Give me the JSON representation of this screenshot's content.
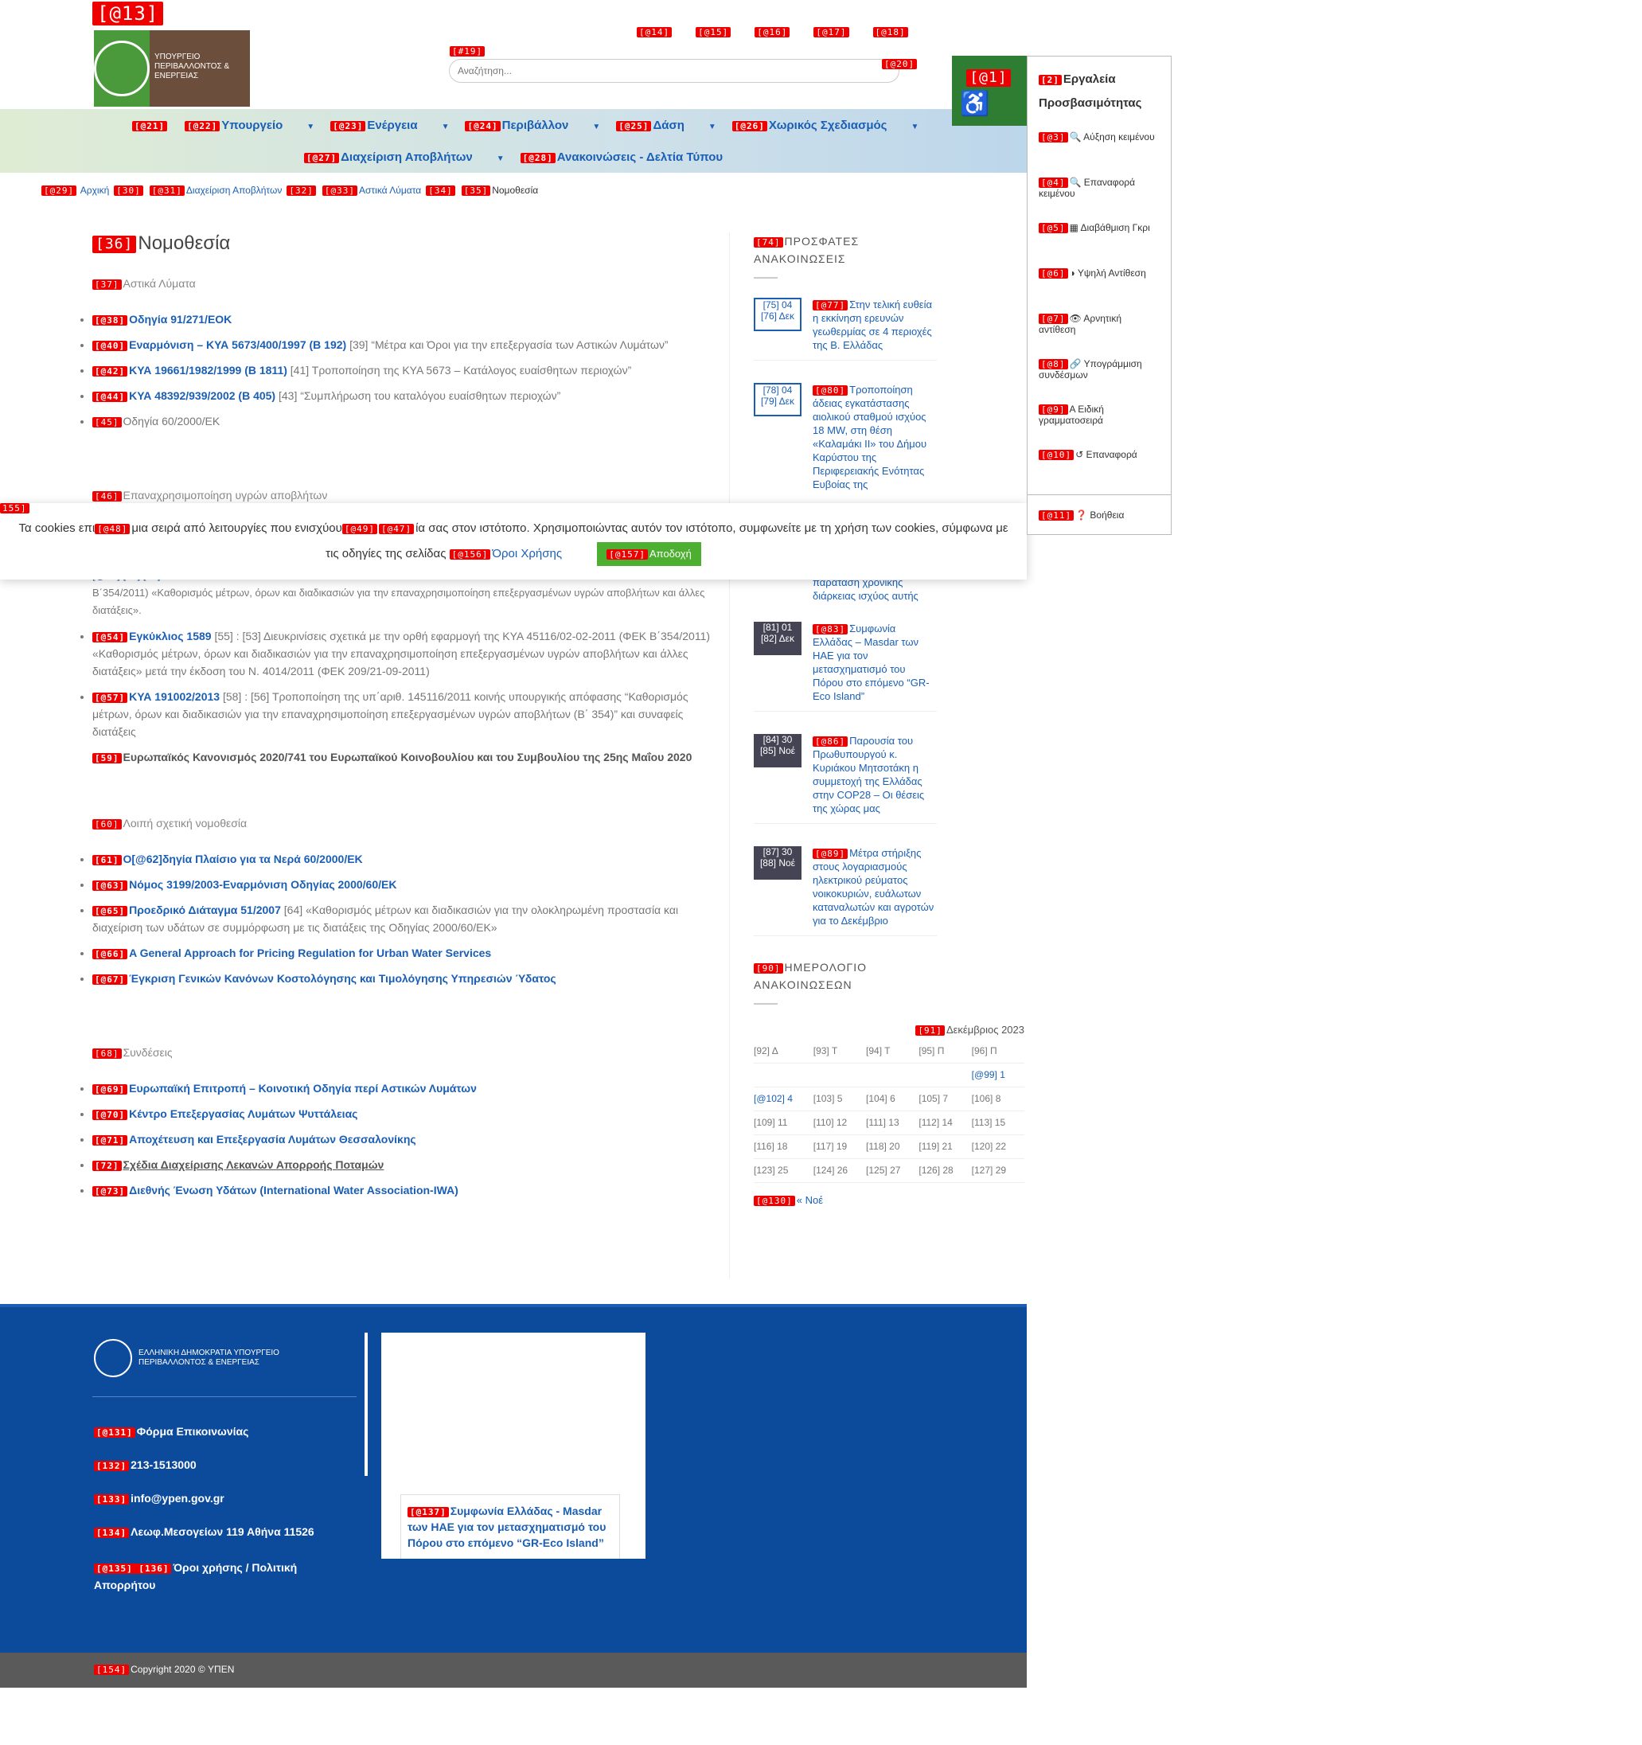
{
  "header": {
    "logo_tag": "[@13]",
    "logo_text": "ΥΠΟΥΡΓΕΙΟ ΠΕΡΙΒΑΛΛΟΝΤΟΣ & ΕΝΕΡΓΕΙΑΣ",
    "toplinks": [
      "[@14]",
      "[@15]",
      "[@16]",
      "[@17]",
      "[@18]"
    ],
    "search_tag": "[#19]",
    "search_placeholder": "Αναζήτηση...",
    "search_btn_tag": "[@20]"
  },
  "nav": {
    "row1": [
      {
        "tag": "[@21]",
        "label": ""
      },
      {
        "tag": "[@22]",
        "label": "Υπουργείο"
      },
      {
        "tag": "[@23]",
        "label": "Ενέργεια"
      },
      {
        "tag": "[@24]",
        "label": "Περιβάλλον"
      },
      {
        "tag": "[@25]",
        "label": "Δάση"
      },
      {
        "tag": "[@26]",
        "label": "Χωρικός Σχεδιασμός"
      }
    ],
    "row2": [
      {
        "tag": "[@27]",
        "label": "Διαχείριση Αποβλήτων"
      },
      {
        "tag": "[@28]",
        "label": "Ανακοινώσεις - Δελτία Τύπου"
      }
    ]
  },
  "breadcrumb": [
    {
      "tag": "[@29]",
      "label": "Αρχική"
    },
    {
      "tag": "[30]",
      "label": ""
    },
    {
      "tag": "[@31]",
      "label": "Διαχείριση Αποβλήτων"
    },
    {
      "tag": "[32]",
      "label": ""
    },
    {
      "tag": "[@33]",
      "label": "Αστικά Λύματα"
    },
    {
      "tag": "[34]",
      "label": ""
    },
    {
      "tag": "[35]",
      "label": "Νομοθεσία"
    }
  ],
  "main": {
    "title_tag": "[36]",
    "title": "Νομοθεσία",
    "s1_tag": "[37]",
    "s1": "Αστικά Λύματα",
    "l1": [
      {
        "tag": "[@38]",
        "link": "Οδηγία 91/271/ΕΟΚ",
        "text": ""
      },
      {
        "tag": "[@40]",
        "link": "Εναρμόνιση – ΚΥΑ 5673/400/1997 (Β 192)",
        "text": "[39] “Μέτρα και Όροι για την επεξεργασία των Αστικών Λυμάτων”"
      },
      {
        "tag": "[@42]",
        "link": "ΚΥΑ 19661/1982/1999 (Β 1811)",
        "text": "[41] Τροποποίηση της ΚΥΑ 5673 – Κατάλογος ευαίσθητων περιοχών”"
      },
      {
        "tag": "[@44]",
        "link": "ΚΥΑ 48392/939/2002 (Β 405)",
        "text": "[43] “Συμπλήρωση του καταλόγου ευαίσθητων περιοχών”"
      },
      {
        "tag": "[45]",
        "link": "",
        "text": "Οδηγία 60/2000/ΕΚ"
      }
    ],
    "s2_tag": "[46]",
    "s2": "Επαναχρησιμοποίηση υγρών αποβλήτων",
    "l2_partial": "[@51]                         [52] [50]",
    "l2_text": "Β΄354/2011) «Καθορισμός μέτρων, όρων και διαδικασιών για την επαναχρησιμοποίηση επεξεργασμένων υγρών αποβλήτων και άλλες διατάξεις».",
    "l2": [
      {
        "tag": "[@54]",
        "link": "Εγκύκλιος 1589",
        "text": "[55] : [53] Διευκρινίσεις σχετικά με την ορθή εφαρμογή της ΚΥΑ 45116/02-02-2011 (ΦΕΚ Β΄354/2011) «Καθορισμός μέτρων, όρων και διαδικασιών για την επαναχρησιμοποίηση επεξεργασμένων υγρών αποβλήτων και άλλες διατάξεις» μετά την έκδοση του Ν. 4014/2011 (ΦΕΚ 209/21-09-2011)"
      },
      {
        "tag": "[@57]",
        "link": "ΚΥΑ 191002/2013",
        "text": "[58] : [56] Τροποποίηση της υπ΄αριθ. 145116/2011 κοινής υπουργικής απόφασης “Καθορισμός μέτρων, όρων και διαδικασιών για την επαναχρησιμοποίηση επεξεργασμένων υγρών αποβλήτων (Β΄ 354)” και συναφείς διατάξεις"
      }
    ],
    "l2_last_tag": "[59]",
    "l2_last": "Ευρωπαϊκός Κανονισμός 2020/741 του Ευρωπαϊκού Κοινοβουλίου και του Συμβουλίου της 25ης Μαΐου 2020",
    "s3_tag": "[60]",
    "s3": "Λοιπή σχετική νομοθεσία",
    "l3": [
      {
        "tag": "[61]",
        "link": "Ο[@62]δηγία Πλαίσιο για τα Νερά 60/2000/ΕΚ",
        "text": ""
      },
      {
        "tag": "[@63]",
        "link": "Νόμος 3199/2003-Εναρμόνιση Οδηγίας 2000/60/ΕΚ",
        "text": ""
      },
      {
        "tag": "[@65]",
        "link": "Προεδρικό Διάταγμα 51/2007",
        "text": "[64] «Καθορισμός μέτρων και διαδικασιών για την ολοκληρωμένη προστασία και διαχείριση των υδάτων σε συμμόρφωση με τις διατάξεις της Οδηγίας 2000/60/ΕΚ»"
      },
      {
        "tag": "[@66]",
        "link": "A General Approach for Pricing Regulation for Urban Water Services",
        "text": ""
      },
      {
        "tag": "[@67]",
        "link": "Έγκριση Γενικών Κανόνων Κοστολόγησης και Τιμολόγησης Υπηρεσιών Ύδατος",
        "text": ""
      }
    ],
    "s4_tag": "[68]",
    "s4": "Συνδέσεις",
    "l4": [
      {
        "tag": "[@69]",
        "link": "Ευρωπαϊκή Επιτροπή – Κοινοτική Οδηγία περί Αστικών Λυμάτων"
      },
      {
        "tag": "[@70]",
        "link": "Κέντρο Επεξεργασίας Λυμάτων Ψυττάλειας"
      },
      {
        "tag": "[@71]",
        "link": "Αποχέτευση και Επεξεργασία Λυμάτων Θεσσαλονίκης"
      },
      {
        "tag": "[72]",
        "link": "Σχέδια Διαχείρισης Λεκανών Απορροής Ποταμών"
      },
      {
        "tag": "[@73]",
        "link": "Διεθνής Ένωση Υδάτων (International Water Association-IWA)"
      }
    ]
  },
  "sidebar": {
    "news_tag": "[74]",
    "news_title": "ΠΡΟΣΦΑΤΕΣ ΑΝΑΚΟΙΝΩΣΕΙΣ",
    "news": [
      {
        "d": "[75] 04",
        "m": "[76] Δεκ",
        "tag": "[@77]",
        "title": "Στην τελική ευθεία η εκκίνηση ερευνών γεωθερμίας σε 4 περιοχές της Β. Ελλάδας"
      },
      {
        "d": "[78] 04",
        "m": "[79] Δεκ",
        "tag": "[@80]",
        "title": "Τροποποίηση άδειας εγκατάστασης αιολικού σταθμού ισχύος 18 MW, στη θέση «Καλαμάκι ΙΙ» του Δήμου Καρύστου της Περιφερειακής Ενότητας Ευβοίας της"
      },
      {
        "d": "[81] 01",
        "m": "[82] Δεκ",
        "tag": "[@83]",
        "title": "Συμφωνία Ελλάδας – Masdar των ΗΑΕ για τον μετασχηματισμό του Πόρου στο επόμενο “GR-Eco Island”"
      },
      {
        "d": "[84] 30",
        "m": "[85] Νοέ",
        "tag": "[@86]",
        "title": "Παρουσία του Πρωθυπουργού κ. Κυριάκου Μητσοτάκη η συμμετοχή της Ελλάδας στην COP28 – Οι θέσεις της χώρας μας"
      },
      {
        "d": "[87] 30",
        "m": "[88] Νοέ",
        "tag": "[@89]",
        "title": "Μέτρα στήριξης στους λογαριασμούς ηλεκτρικού ρεύματος νοικοκυριών, ευάλωτων καταναλωτών και αγροτών για το Δεκέμβριο"
      }
    ],
    "news_fragment": "λόγω αλλαγής θέσης ανεμογεννητριών και παράταση χρονικής διάρκειας ισχύος αυτής",
    "cal_tag": "[90]",
    "cal_title": "ΗΜΕΡΟΛΟΓΙΟ ΑΝΑΚΟΙΝΩΣΕΩΝ",
    "cal_month_tag": "[91]",
    "cal_month": "Δεκέμβριος 2023",
    "cal_head": [
      "[92] Δ",
      "[93] Τ",
      "[94] Τ",
      "[95] Π",
      "[96] Π"
    ],
    "cal_rows": [
      [
        "",
        "",
        "",
        "",
        "[@99] 1"
      ],
      [
        "[@102] 4",
        "[103] 5",
        "[104] 6",
        "[105] 7",
        "[106] 8"
      ],
      [
        "[109] 11",
        "[110] 12",
        "[111] 13",
        "[112] 14",
        "[113] 15"
      ],
      [
        "[116] 18",
        "[117] 19",
        "[118] 20",
        "[119] 21",
        "[120] 22"
      ],
      [
        "[123] 25",
        "[124] 26",
        "[125] 27",
        "[126] 28",
        "[127] 29"
      ]
    ],
    "cal_prev_tag": "[@130]",
    "cal_prev": "« Νοέ"
  },
  "cookie": {
    "side_tag": "155]",
    "line1a": "Τα cookies επι",
    "tag48": "[@48]",
    "line1b": "μια σειρά από λειτουργίες που ενισχύου",
    "tag49": "[@49]",
    "tag47": "[@47]",
    "line1c": "ία σας στον ιστότοπο. Χρησιμοποιώντας αυτόν τον ιστότοπο, συμφωνείτε με τη χρήση των cookies, σύμφωνα με",
    "line2": "τις οδηγίες της σελίδας",
    "terms_tag": "[@156]",
    "terms": "Όροι Χρήσης",
    "accept_tag": "[@157]",
    "accept": "Αποδοχή"
  },
  "accessibility": {
    "btn_tag": "[@1]",
    "title_tag": "[2]",
    "title": "Εργαλεία Προσβασιμότητας",
    "items": [
      {
        "tag": "[@3]",
        "label": "Αύξηση κειμένου",
        "icon": "🔍"
      },
      {
        "tag": "[@4]",
        "label": "Επαναφορά κειμένου",
        "icon": "🔍"
      },
      {
        "tag": "[@5]",
        "label": "Διαβάθμιση Γκρι",
        "icon": "▦"
      },
      {
        "tag": "[@6]",
        "label": "Υψηλή Αντίθεση",
        "icon": "◑"
      },
      {
        "tag": "[@7]",
        "label": "Αρνητική αντίθεση",
        "icon": "👁"
      },
      {
        "tag": "[@8]",
        "label": "Υπογράμμιση συνδέσμων",
        "icon": "🔗"
      },
      {
        "tag": "[@9]",
        "label": "Ειδική γραμματοσειρά",
        "icon": "A"
      },
      {
        "tag": "[@10]",
        "label": "Επαναφορά",
        "icon": "↺"
      }
    ],
    "help_tag": "[@11]",
    "help": "Βοήθεια"
  },
  "footer": {
    "logo_text": "ΕΛΛΗΝΙΚΗ ΔΗΜΟΚΡΑΤΙΑ ΥΠΟΥΡΓΕΙΟ ΠΕΡΙΒΑΛΛΟΝΤΟΣ & ΕΝΕΡΓΕΙΑΣ",
    "items": [
      {
        "tag": "[@131]",
        "label": "Φόρμα Επικοινωνίας"
      },
      {
        "tag": "[132]",
        "label": "213-1513000"
      },
      {
        "tag": "[133]",
        "label": "info@ypen.gov.gr"
      },
      {
        "tag": "[134]",
        "label": "Λεωφ.Μεσογείων 119 Αθήνα 11526"
      }
    ],
    "terms_tag": "[@135] [136]",
    "terms": "Όροι χρήσης / Πολιτική Απορρήτου",
    "box_tag": "[@137]",
    "box": "Συμφωνία Ελλάδας - Masdar των ΗΑΕ για τον μετασχηματισμό του Πόρου στο επόμενο “GR-Eco Island”",
    "copy_tag": "[154]",
    "copy": "Copyright 2020 © ΥΠΕΝ"
  },
  "colors": {
    "accent": "#1a5fb4",
    "footer": "#0c4a9c",
    "accept": "#4caf2f",
    "acc_btn": "#2e7d32"
  }
}
